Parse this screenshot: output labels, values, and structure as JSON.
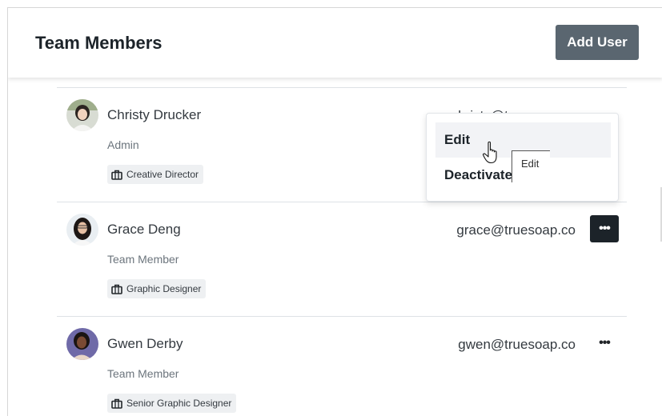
{
  "header": {
    "title": "Team Members",
    "add_button": "Add User"
  },
  "members": [
    {
      "name": "Christy Drucker",
      "role": "Admin",
      "title": "Creative Director",
      "email": "christy@truesoap.co"
    },
    {
      "name": "Grace Deng",
      "role": "Team Member",
      "title": "Graphic Designer",
      "email": "grace@truesoap.co"
    },
    {
      "name": "Gwen Derby",
      "role": "Team Member",
      "title": "Senior Graphic Designer",
      "email": "gwen@truesoap.co"
    }
  ],
  "menu": {
    "items": [
      "Edit",
      "Deactivate"
    ]
  },
  "tooltip": "Edit",
  "more_icon": "•••",
  "colors": {
    "button": "#5a6670",
    "active_more": "#1c2329",
    "badge_bg": "#eef0f2"
  }
}
